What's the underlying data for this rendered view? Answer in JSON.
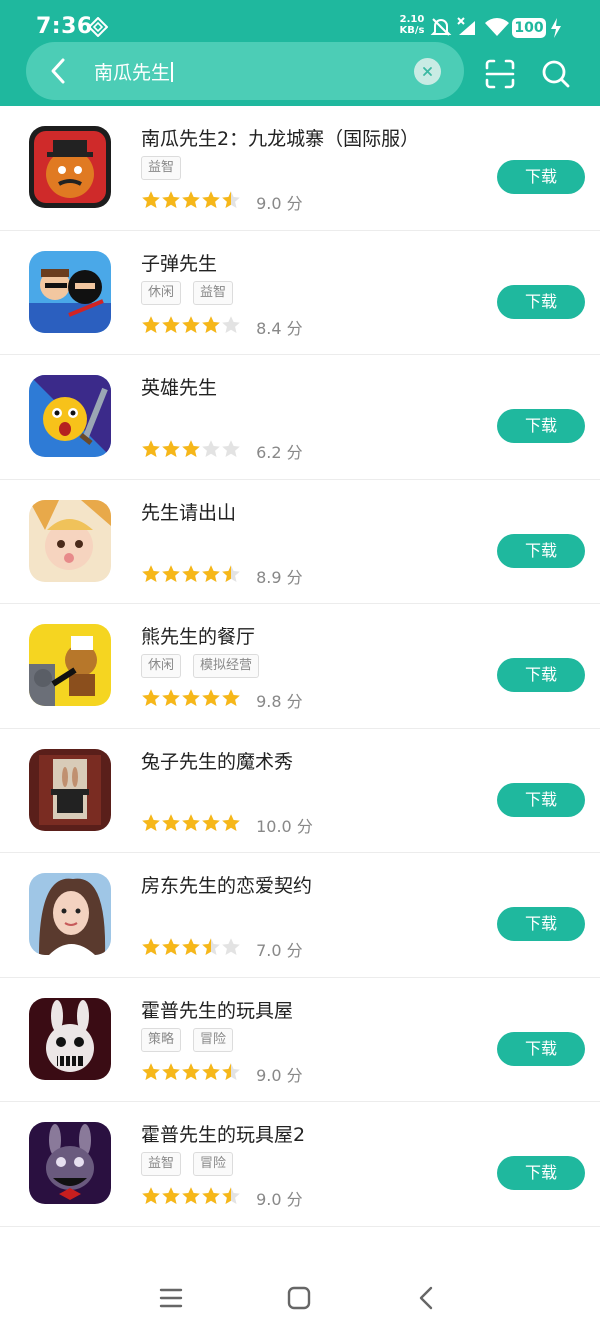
{
  "status_bar": {
    "time": "7:36",
    "net_speed_value": "2.10",
    "net_speed_unit": "KB/s",
    "battery": "100"
  },
  "search": {
    "query": "南瓜先生",
    "icons": [
      "back-arrow-icon",
      "clear-icon",
      "scan-icon",
      "search-icon"
    ]
  },
  "download_label": "下载",
  "rating_unit": "分",
  "apps": [
    {
      "name": "南瓜先生2：九龙城寨（国际服）",
      "tags": [
        "益智"
      ],
      "stars": 4.5,
      "score": "9.0"
    },
    {
      "name": "子弹先生",
      "tags": [
        "休闲",
        "益智"
      ],
      "stars": 4,
      "score": "8.4"
    },
    {
      "name": "英雄先生",
      "tags": [],
      "stars": 3,
      "score": "6.2"
    },
    {
      "name": "先生请出山",
      "tags": [],
      "stars": 4.5,
      "score": "8.9"
    },
    {
      "name": "熊先生的餐厅",
      "tags": [
        "休闲",
        "模拟经营"
      ],
      "stars": 5,
      "score": "9.8"
    },
    {
      "name": "兔子先生的魔术秀",
      "tags": [],
      "stars": 5,
      "score": "10.0"
    },
    {
      "name": "房东先生的恋爱契约",
      "tags": [],
      "stars": 3.5,
      "score": "7.0"
    },
    {
      "name": "霍普先生的玩具屋",
      "tags": [
        "策略",
        "冒险"
      ],
      "stars": 4.5,
      "score": "9.0"
    },
    {
      "name": "霍普先生的玩具屋2",
      "tags": [
        "益智",
        "冒险"
      ],
      "stars": 4.5,
      "score": "9.0"
    }
  ],
  "colors": {
    "accent": "#1fb89e",
    "star": "#f6b719",
    "star_empty": "#e3e3e3"
  },
  "nav_icons": [
    "menu-icon",
    "home-icon",
    "back-icon"
  ]
}
